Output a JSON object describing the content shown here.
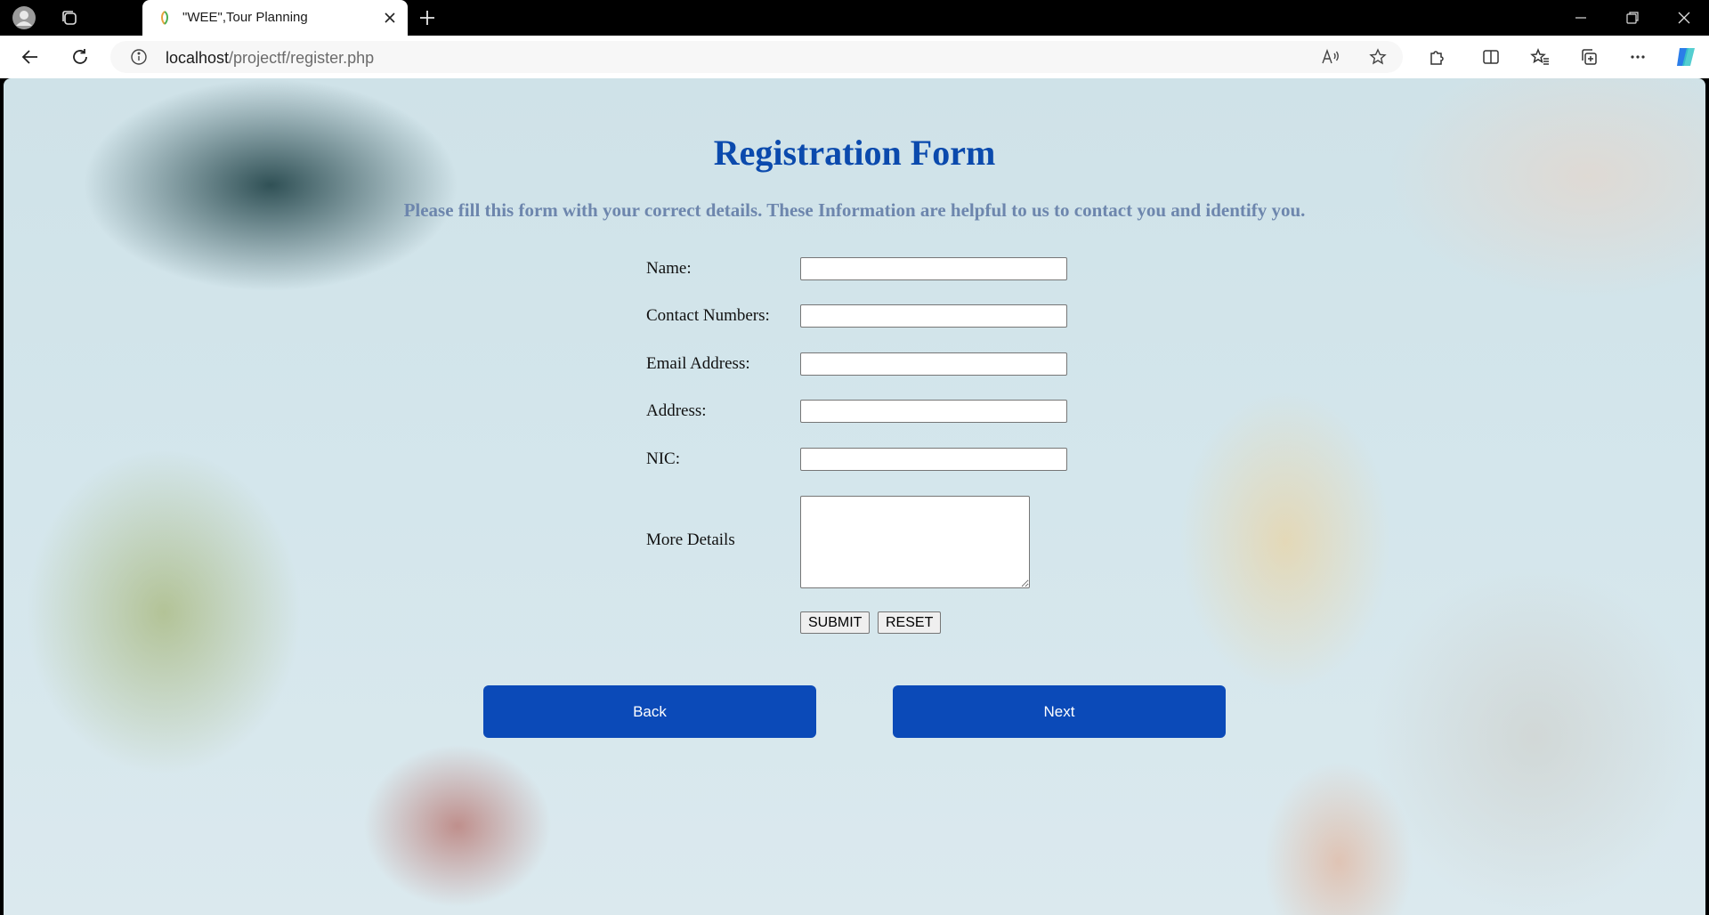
{
  "browser": {
    "tab_title": "\"WEE\",Tour Planning",
    "url_host": "localhost",
    "url_path": "/projectf/register.php",
    "accent": "#0b4ab8"
  },
  "page": {
    "heading": "Registration Form",
    "subtitle": "Please fill this form with your correct details. These Information are helpful to us to contact you and identify you.",
    "fields": {
      "name_label": "Name:",
      "contact_label": "Contact Numbers:",
      "email_label": "Email Address:",
      "address_label": "Address:",
      "nic_label": "NIC:",
      "details_label": "More Details"
    },
    "submit_label": "SUBMIT",
    "reset_label": "RESET",
    "back_label": "Back",
    "next_label": "Next",
    "heading_color": "#0b4aad",
    "button_color": "#0b4ab8"
  }
}
